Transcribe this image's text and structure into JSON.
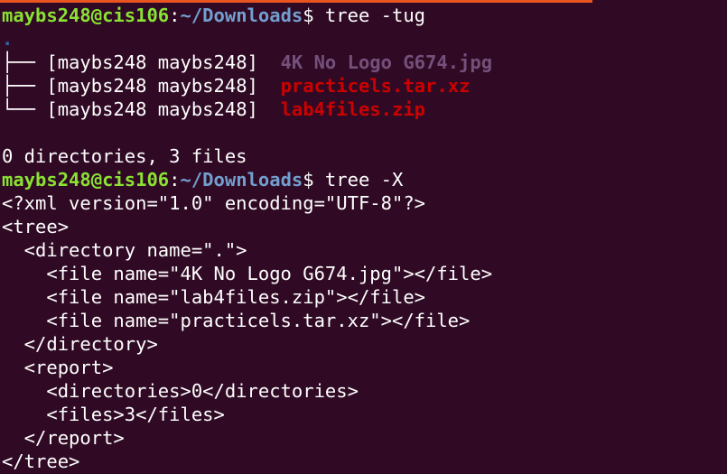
{
  "colors": {
    "background": "#300a24",
    "prompt_user": "#8ae234",
    "prompt_path": "#729fcf",
    "text": "#ffffff",
    "image_file": "#75507b",
    "archive_file": "#cc0000",
    "dot_dir": "#3465a4",
    "accent_bar": "#e95420"
  },
  "prompt": {
    "user_host": "maybs248@cis106",
    "sep": ":",
    "path": "~/Downloads",
    "symbol": "$"
  },
  "cmd1": " tree -tug",
  "tree_root": ".",
  "tree_entries": [
    {
      "branch": "├── ",
      "owner": "[maybs248 maybs248]  ",
      "name": "4K No Logo G674.jpg"
    },
    {
      "branch": "├── ",
      "owner": "[maybs248 maybs248]  ",
      "name": "practicels.tar.xz"
    },
    {
      "branch": "└── ",
      "owner": "[maybs248 maybs248]  ",
      "name": "lab4files.zip"
    }
  ],
  "summary": "0 directories, 3 files",
  "cmd2": " tree -X",
  "xml_lines": [
    "<?xml version=\"1.0\" encoding=\"UTF-8\"?>",
    "<tree>",
    "  <directory name=\".\">",
    "    <file name=\"4K No Logo G674.jpg\"></file>",
    "    <file name=\"lab4files.zip\"></file>",
    "    <file name=\"practicels.tar.xz\"></file>",
    "  </directory>",
    "  <report>",
    "    <directories>0</directories>",
    "    <files>3</files>",
    "  </report>",
    "</tree>"
  ]
}
